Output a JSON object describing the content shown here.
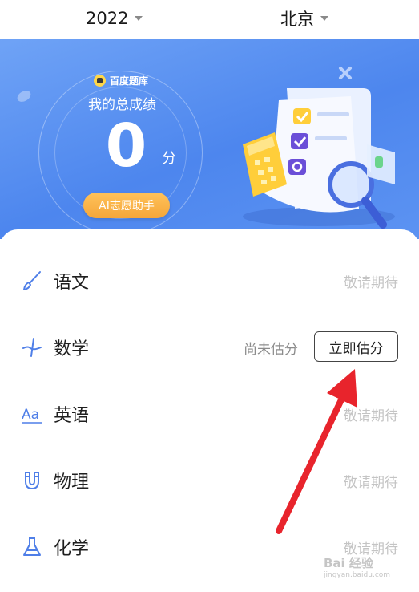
{
  "header": {
    "year": "2022",
    "city": "北京"
  },
  "banner": {
    "brand": "百度题库",
    "score_title": "我的总成绩",
    "score_value": "0",
    "score_unit": "分",
    "ai_button": "AI志愿助手"
  },
  "subjects": [
    {
      "name": "语文",
      "icon": "brush-icon",
      "status": "敬请期待"
    },
    {
      "name": "数学",
      "icon": "math-icon",
      "pending": "尚未估分",
      "action": "立即估分"
    },
    {
      "name": "英语",
      "icon": "aa-letters-icon",
      "status": "敬请期待"
    },
    {
      "name": "物理",
      "icon": "magnet-icon",
      "status": "敬请期待"
    },
    {
      "name": "化学",
      "icon": "flask-icon",
      "status": "敬请期待"
    }
  ],
  "watermark": {
    "text": "Bai 经验",
    "sub": "jingyan.baidu.com"
  },
  "colors": {
    "banner_blue": "#4d86ee",
    "ai_button_orange": "#f5a63a",
    "annotation_arrow": "#e8242c",
    "icon_blue": "#4f7fe8"
  }
}
